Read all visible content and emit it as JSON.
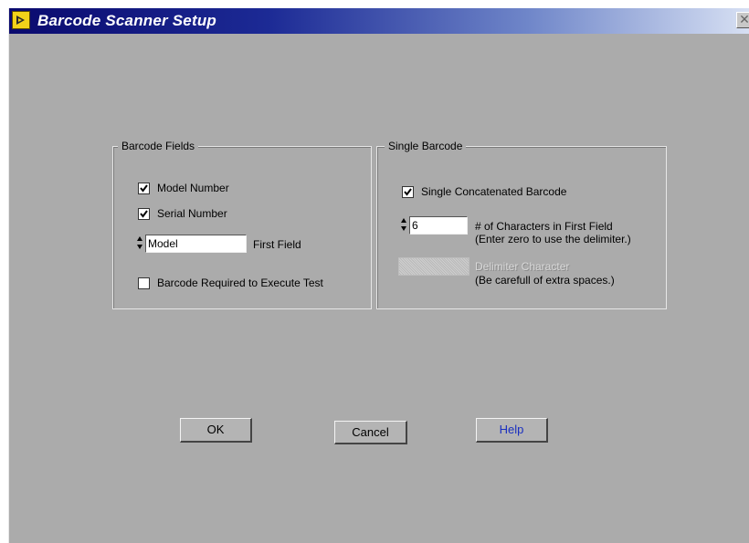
{
  "window": {
    "title": "Barcode Scanner Setup",
    "close_glyph": "✕",
    "icon": "labview-vi-icon",
    "colors": {
      "titlebar_start": "#0a0a6e",
      "titlebar_end": "#d7e0f3",
      "panel": "#ababab"
    }
  },
  "barcode_fields": {
    "title": "Barcode Fields",
    "model_number": {
      "label": "Model Number",
      "checked": true
    },
    "serial_number": {
      "label": "Serial Number",
      "checked": true
    },
    "first_field": {
      "value": "Model",
      "label": "First Field"
    },
    "required": {
      "label": "Barcode Required to Execute Test",
      "checked": false
    }
  },
  "single_barcode": {
    "title": "Single Barcode",
    "concatenated": {
      "label": "Single Concatenated Barcode",
      "checked": true
    },
    "chars_first_field": {
      "value": "6",
      "label_line1": "# of Characters in First Field",
      "label_line2": "(Enter zero to use the delimiter.)"
    },
    "delimiter": {
      "value": "",
      "label_line1": "Delimiter Character",
      "label_line2": "(Be carefull of extra spaces.)"
    }
  },
  "buttons": {
    "ok": "OK",
    "cancel": "Cancel",
    "help": "Help"
  }
}
